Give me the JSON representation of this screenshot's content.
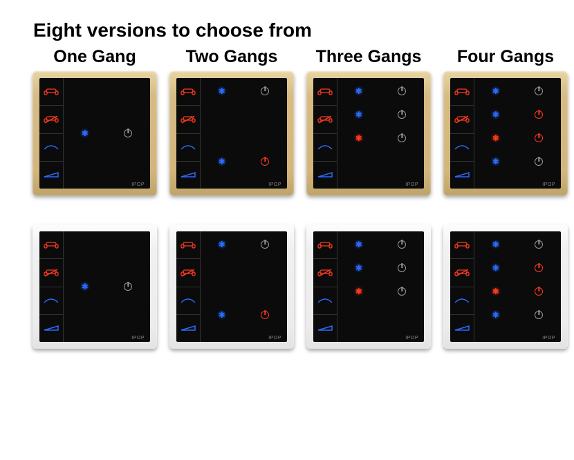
{
  "title": "Eight versions to choose from",
  "columns": [
    "One Gang",
    "Two Gangs",
    "Three Gangs",
    "Four Gangs"
  ],
  "brand": "IPOP",
  "side_icons": [
    "sofa-icon",
    "sofa-off-icon",
    "curve-icon",
    "wedge-icon"
  ],
  "side_colors": [
    "#ff3a1f",
    "#ff3a1f",
    "#2a6bff",
    "#2a6bff"
  ],
  "frames": [
    "gold",
    "white"
  ],
  "layouts": {
    "one": [
      {
        "pos": "mid",
        "cells": [
          "star",
          "pwr"
        ]
      }
    ],
    "two": [
      {
        "pos": "upper",
        "cells": [
          "star",
          "pwr"
        ]
      },
      {
        "pos": "lower",
        "cells": [
          "star",
          "pwr-red"
        ]
      }
    ],
    "three": [
      {
        "pos": "r0",
        "cells": [
          "star",
          "pwr"
        ]
      },
      {
        "pos": "r1",
        "cells": [
          "star",
          "pwr"
        ]
      },
      {
        "pos": "r2",
        "cells": [
          "star-red",
          "pwr"
        ]
      }
    ],
    "four": [
      {
        "pos": "r0",
        "cells": [
          "star",
          "pwr"
        ]
      },
      {
        "pos": "r1",
        "cells": [
          "star",
          "pwr-red"
        ]
      },
      {
        "pos": "r2",
        "cells": [
          "star-red",
          "pwr-red"
        ]
      },
      {
        "pos": "r3",
        "cells": [
          "star",
          "pwr"
        ]
      }
    ]
  }
}
